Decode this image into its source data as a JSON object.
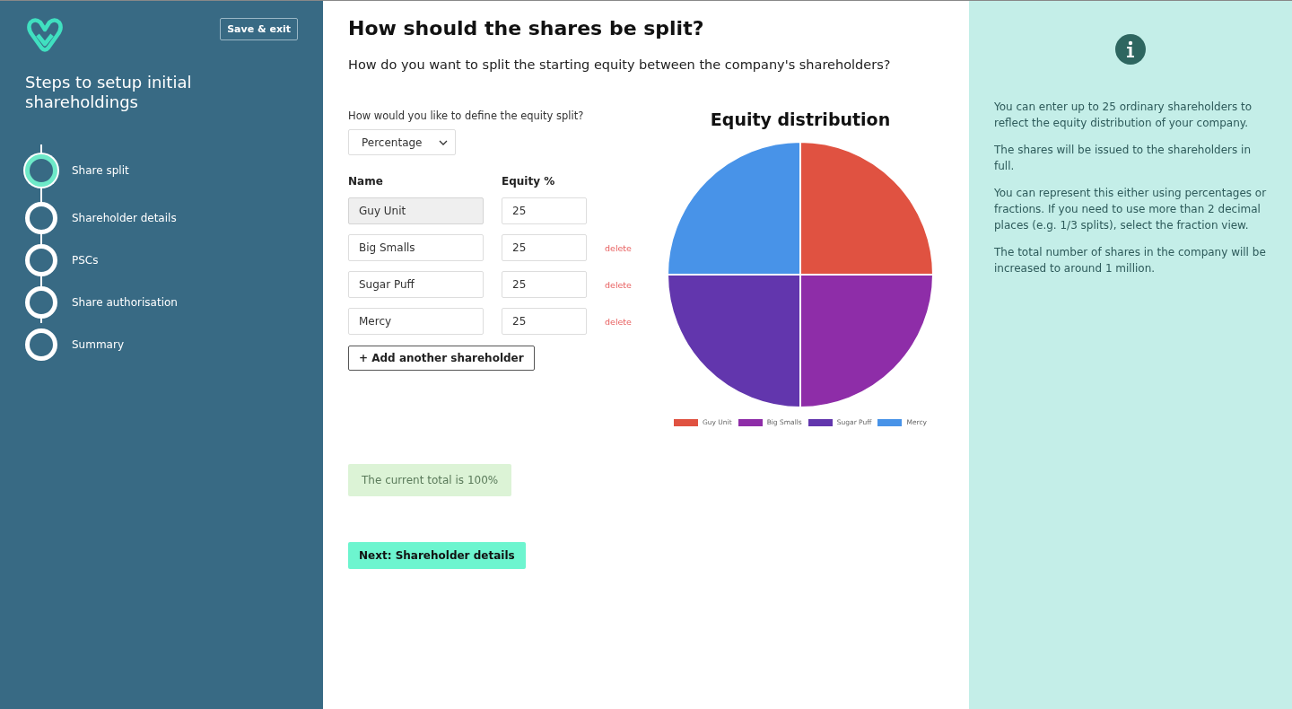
{
  "sidebar": {
    "save_button": "Save & exit",
    "title": "Steps to setup initial shareholdings",
    "steps": [
      {
        "label": "Share split",
        "selected": true
      },
      {
        "label": "Shareholder details",
        "selected": false
      },
      {
        "label": "PSCs",
        "selected": false
      },
      {
        "label": "Share authorisation",
        "selected": false
      },
      {
        "label": "Summary",
        "selected": false
      }
    ]
  },
  "main": {
    "heading": "How should the shares be split?",
    "intro": "How do you want to split the starting equity between the company's shareholders?",
    "split_question": "How would you like to define the equity split?",
    "split_select": "Percentage",
    "columns": [
      "Name",
      "Equity %"
    ],
    "rows": [
      {
        "name": "Guy Unit",
        "equity": "25",
        "disabled": true
      },
      {
        "name": "Big Smalls",
        "equity": "25",
        "disabled": false,
        "delete": "delete"
      },
      {
        "name": "Sugar Puff",
        "equity": "25",
        "disabled": false,
        "delete": "delete"
      },
      {
        "name": "Mercy",
        "equity": "25",
        "disabled": false,
        "delete": "delete"
      }
    ],
    "add_button": "+ Add another shareholder",
    "total_message": "The current total is 100%",
    "next_button": "Next: Shareholder details",
    "chart": {
      "chart_data": {
        "type": "pie",
        "title": "Equity distribution",
        "categories": [
          "Guy Unit",
          "Big Smalls",
          "Sugar Puff",
          "Mercy"
        ],
        "values": [
          25,
          25,
          25,
          25
        ],
        "colors": [
          "#e05241",
          "#8e2da8",
          "#6236ad",
          "#4893e8"
        ]
      }
    }
  },
  "info": {
    "paragraphs": [
      "You can enter up to 25 ordinary shareholders to reflect the equity distribution of your company.",
      "The shares will be issued to the shareholders in full.",
      "You can represent this either using percentages or fractions. If you need to use more than 2 decimal places (e.g. 1/3 splits), select the fraction view.",
      "The total number of shares in the company will be increased to around 1 million."
    ]
  }
}
